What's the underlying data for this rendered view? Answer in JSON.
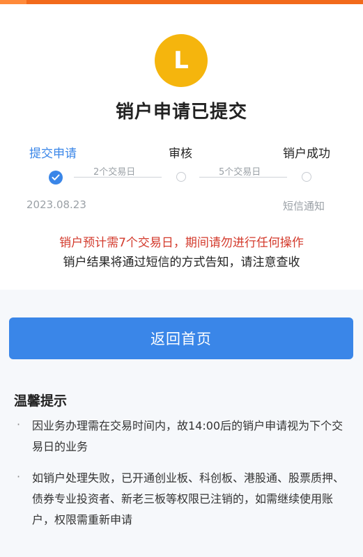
{
  "title": "销户申请已提交",
  "avatar": {
    "letter": "L",
    "color": "#f5b50d"
  },
  "steps": [
    {
      "label": "提交申请",
      "state": "done"
    },
    {
      "label": "审核",
      "state": "pending"
    },
    {
      "label": "销户成功",
      "state": "pending"
    }
  ],
  "durations": [
    "2个交易日",
    "5个交易日"
  ],
  "step_notes": {
    "date": "2023.08.23",
    "sms": "短信通知"
  },
  "warning": "销户预计需7个交易日，期间请勿进行任何操作",
  "notice": "销户结果将通过短信的方式告知，请注意查收",
  "home_button": "返回首页",
  "tips": {
    "title": "温馨提示",
    "items": [
      "因业务办理需在交易时间内，故14:00后的销户申请视为下个交易日的业务",
      "如销户处理失败，已开通创业板、科创板、港股通、股票质押、债券专业投资者、新老三板等权限已注销的，如需继续使用账户，权限需重新申请"
    ]
  },
  "colors": {
    "accent": "#3a86e8",
    "warning": "#d33a2c",
    "header": "#f26a1b"
  }
}
